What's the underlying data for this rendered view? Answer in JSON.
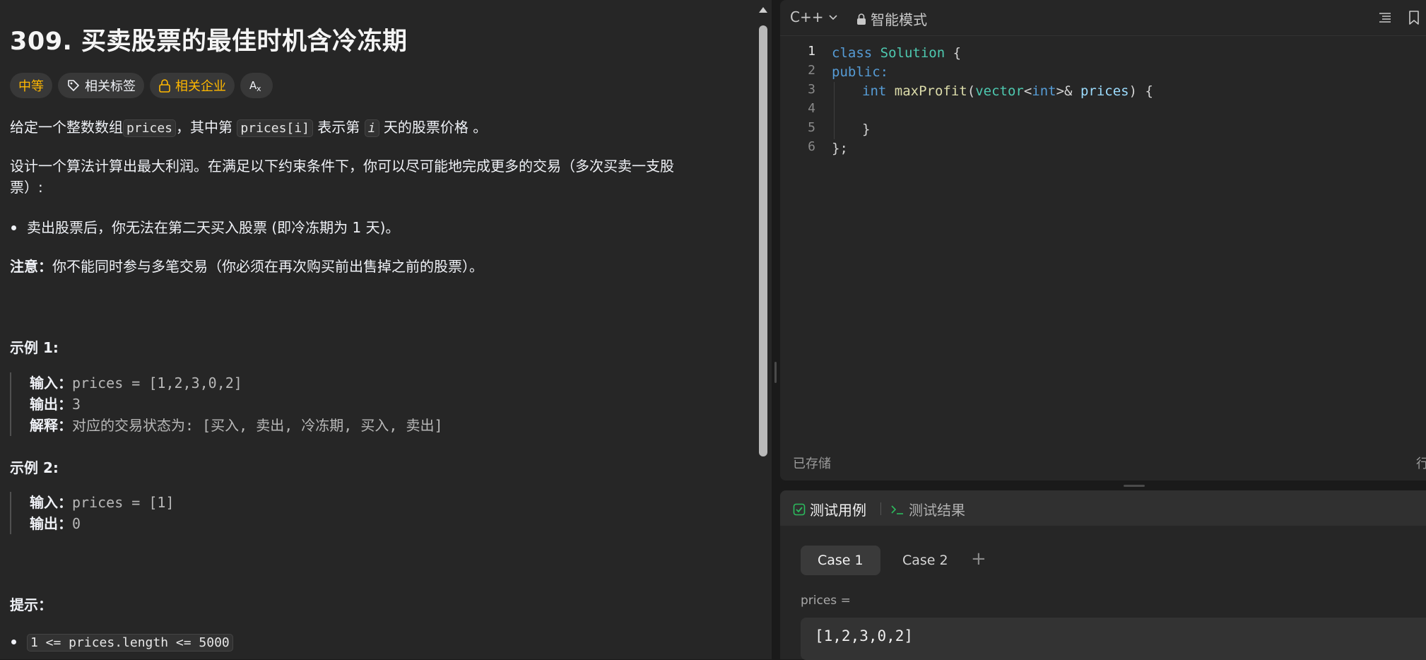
{
  "problem": {
    "title": "309. 买卖股票的最佳时机含冷冻期",
    "tags": {
      "difficulty": "中等",
      "topics": "相关标签",
      "companies": "相关企业"
    },
    "desc1": {
      "a": "给定一个整数数组",
      "code1": "prices",
      "b": "，其中第 ",
      "code2": "prices[i]",
      "c": " 表示第 ",
      "code3": "i",
      "d": " 天的股票价格 。"
    },
    "desc2_line1": "设计一个算法计算出最大利润。在满足以下约束条件下，你可以尽可能地完成更多的交易（多次买卖一支股",
    "desc2_line2": "票）:",
    "bullet1": "卖出股票后，你无法在第二天买入股票 (即冷冻期为 1 天)。",
    "note_label": "注意：",
    "note_text": "你不能同时参与多笔交易（你必须在再次购买前出售掉之前的股票）。",
    "example1": {
      "heading": "示例 1:",
      "input_label": "输入：",
      "input_value": "prices = [1,2,3,0,2]",
      "output_label": "输出：",
      "output_value": "3",
      "explain_label": "解释：",
      "explain_value": "对应的交易状态为: [买入, 卖出, 冷冻期, 买入, 卖出]"
    },
    "example2": {
      "heading": "示例 2:",
      "input_label": "输入：",
      "input_value": "prices = [1]",
      "output_label": "输出：",
      "output_value": "0"
    },
    "hints_heading": "提示：",
    "hint1": "1 <= prices.length <= 5000"
  },
  "editor": {
    "language": "C++",
    "mode": "智能模式",
    "line_numbers": [
      "1",
      "2",
      "3",
      "4",
      "5",
      "6"
    ],
    "lines": {
      "l1_kw": "class",
      "l1_type": "Solution",
      "l1_rest": " {",
      "l2": "public:",
      "l3_kw": "int",
      "l3_fn": "maxProfit",
      "l3_p1": "(",
      "l3_t1": "vector",
      "l3_p2": "<",
      "l3_t2": "int",
      "l3_p3": ">& ",
      "l3_id": "prices",
      "l3_p4": ") {",
      "l5": "}",
      "l6": "};"
    },
    "saved": "已存储",
    "right_edge_letter": "行"
  },
  "tests": {
    "tab_testcase": "测试用例",
    "tab_result": "测试结果",
    "cases": [
      "Case 1",
      "Case 2"
    ],
    "add": "+",
    "param_label": "prices =",
    "param_value": "[1,2,3,0,2]"
  },
  "colors": {
    "accent_difficulty": "#ffb800",
    "testcase_icon": "#2cbb5d",
    "keyword": "#569cd6",
    "type": "#4ec9b0",
    "function": "#dcdcaa"
  }
}
